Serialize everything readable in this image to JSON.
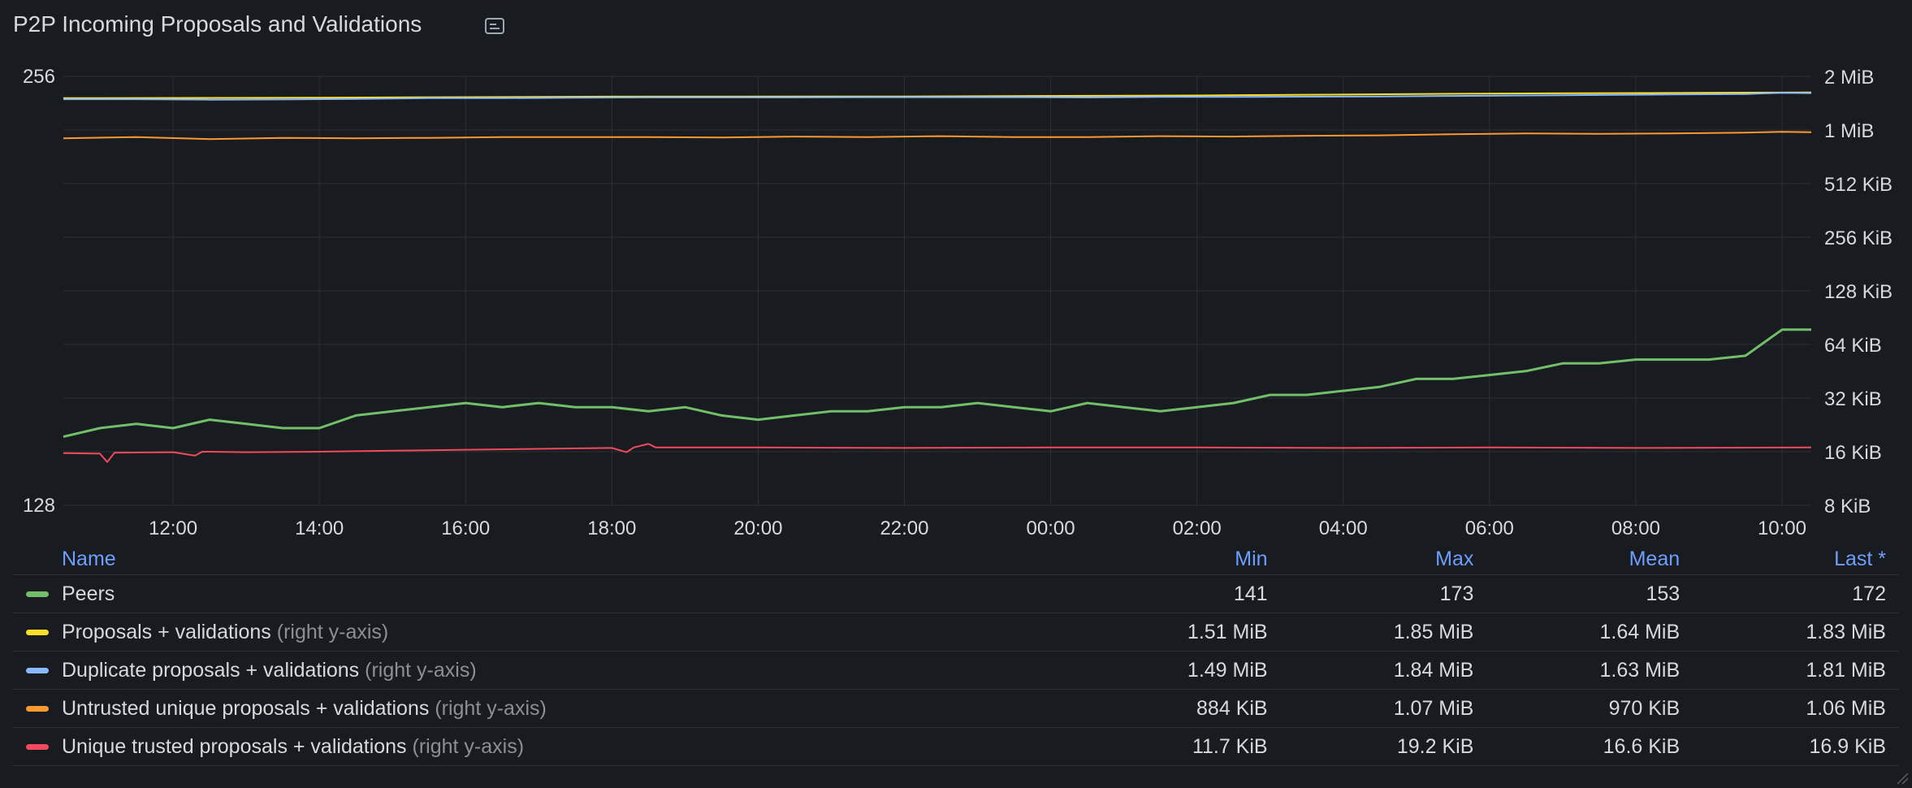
{
  "panel": {
    "title": "P2P Incoming Proposals and Validations",
    "description_icon": "note-icon"
  },
  "colors": {
    "background": "#181b1f",
    "grid": "#2c3036",
    "axis_text": "#d8d9da",
    "legend_header": "#6e9fff"
  },
  "chart_data": {
    "type": "line",
    "x_ticks": [
      "12:00",
      "14:00",
      "16:00",
      "18:00",
      "20:00",
      "22:00",
      "00:00",
      "02:00",
      "04:00",
      "06:00",
      "08:00",
      "10:00"
    ],
    "x_range_hours": [
      10.5,
      34.4
    ],
    "left_axis": {
      "ticks": [
        "256",
        "128"
      ],
      "range": [
        128,
        256
      ],
      "scale": "log2"
    },
    "right_axis": {
      "ticks": [
        "2 MiB",
        "1 MiB",
        "512 KiB",
        "256 KiB",
        "128 KiB",
        "64 KiB",
        "32 KiB",
        "16 KiB",
        "8 KiB"
      ],
      "range_kib": [
        8,
        2048
      ],
      "scale": "log2"
    },
    "grid": true,
    "legend_placement": "bottom (table)",
    "series": [
      {
        "name": "Peers",
        "axis": "left",
        "color": "#73bf69",
        "points": [
          [
            10.5,
            143
          ],
          [
            11.0,
            145
          ],
          [
            11.5,
            146
          ],
          [
            12.0,
            145
          ],
          [
            12.5,
            147
          ],
          [
            13.0,
            146
          ],
          [
            13.5,
            145
          ],
          [
            14.0,
            145
          ],
          [
            14.5,
            148
          ],
          [
            15.0,
            149
          ],
          [
            15.5,
            150
          ],
          [
            16.0,
            151
          ],
          [
            16.5,
            150
          ],
          [
            17.0,
            151
          ],
          [
            17.5,
            150
          ],
          [
            18.0,
            150
          ],
          [
            18.5,
            149
          ],
          [
            19.0,
            150
          ],
          [
            19.5,
            148
          ],
          [
            20.0,
            147
          ],
          [
            20.5,
            148
          ],
          [
            21.0,
            149
          ],
          [
            21.5,
            149
          ],
          [
            22.0,
            150
          ],
          [
            22.5,
            150
          ],
          [
            23.0,
            151
          ],
          [
            23.5,
            150
          ],
          [
            24.0,
            149
          ],
          [
            24.5,
            151
          ],
          [
            25.0,
            150
          ],
          [
            25.5,
            149
          ],
          [
            26.0,
            150
          ],
          [
            26.5,
            151
          ],
          [
            27.0,
            153
          ],
          [
            27.5,
            153
          ],
          [
            28.0,
            154
          ],
          [
            28.5,
            155
          ],
          [
            29.0,
            157
          ],
          [
            29.5,
            157
          ],
          [
            30.0,
            158
          ],
          [
            30.5,
            159
          ],
          [
            31.0,
            161
          ],
          [
            31.5,
            161
          ],
          [
            32.0,
            162
          ],
          [
            32.5,
            162
          ],
          [
            33.0,
            162
          ],
          [
            33.5,
            163
          ],
          [
            34.0,
            170
          ],
          [
            34.4,
            170
          ]
        ]
      },
      {
        "name": "Proposals + validations",
        "axis": "right",
        "color": "#fade2a",
        "points": [
          [
            10.5,
            1546
          ],
          [
            14.0,
            1556
          ],
          [
            18.0,
            1576
          ],
          [
            22.0,
            1580
          ],
          [
            26.0,
            1600
          ],
          [
            30.0,
            1640
          ],
          [
            34.4,
            1665
          ]
        ]
      },
      {
        "name": "Duplicate proposals + validations",
        "axis": "right",
        "color": "#8ab8ff",
        "points": [
          [
            10.5,
            1525
          ],
          [
            11.5,
            1525
          ],
          [
            12.5,
            1515
          ],
          [
            13.5,
            1520
          ],
          [
            14.5,
            1530
          ],
          [
            15.5,
            1545
          ],
          [
            16.5,
            1545
          ],
          [
            17.5,
            1555
          ],
          [
            18.5,
            1560
          ],
          [
            19.5,
            1560
          ],
          [
            20.5,
            1560
          ],
          [
            21.5,
            1565
          ],
          [
            22.5,
            1565
          ],
          [
            23.5,
            1565
          ],
          [
            24.5,
            1560
          ],
          [
            25.5,
            1570
          ],
          [
            26.5,
            1570
          ],
          [
            27.5,
            1575
          ],
          [
            28.5,
            1580
          ],
          [
            29.5,
            1590
          ],
          [
            30.5,
            1600
          ],
          [
            31.5,
            1610
          ],
          [
            32.5,
            1620
          ],
          [
            33.5,
            1630
          ],
          [
            34.0,
            1655
          ],
          [
            34.4,
            1650
          ]
        ]
      },
      {
        "name": "Untrusted unique proposals + validations",
        "axis": "right",
        "color": "#ff9830",
        "points": [
          [
            10.5,
            920
          ],
          [
            11.5,
            935
          ],
          [
            12.5,
            910
          ],
          [
            13.5,
            925
          ],
          [
            14.5,
            920
          ],
          [
            15.5,
            925
          ],
          [
            16.5,
            935
          ],
          [
            17.5,
            935
          ],
          [
            18.5,
            935
          ],
          [
            19.5,
            930
          ],
          [
            20.5,
            940
          ],
          [
            21.5,
            935
          ],
          [
            22.5,
            945
          ],
          [
            23.5,
            935
          ],
          [
            24.5,
            935
          ],
          [
            25.5,
            945
          ],
          [
            26.5,
            940
          ],
          [
            27.5,
            950
          ],
          [
            28.5,
            955
          ],
          [
            29.5,
            970
          ],
          [
            30.5,
            980
          ],
          [
            31.5,
            975
          ],
          [
            32.5,
            980
          ],
          [
            33.5,
            990
          ],
          [
            34.0,
            1000
          ],
          [
            34.4,
            995
          ]
        ]
      },
      {
        "name": "Unique trusted proposals + validations",
        "axis": "right",
        "color": "#f2495c",
        "points": [
          [
            10.5,
            15.7
          ],
          [
            11.0,
            15.6
          ],
          [
            11.1,
            14.0
          ],
          [
            11.2,
            15.8
          ],
          [
            12.0,
            15.9
          ],
          [
            12.3,
            15.2
          ],
          [
            12.4,
            16.0
          ],
          [
            13.0,
            15.9
          ],
          [
            14.0,
            16.0
          ],
          [
            15.0,
            16.2
          ],
          [
            16.0,
            16.4
          ],
          [
            17.0,
            16.6
          ],
          [
            18.0,
            16.8
          ],
          [
            18.2,
            15.9
          ],
          [
            18.3,
            16.9
          ],
          [
            18.5,
            17.7
          ],
          [
            18.6,
            16.9
          ],
          [
            20.0,
            16.9
          ],
          [
            22.0,
            16.8
          ],
          [
            24.0,
            16.9
          ],
          [
            26.0,
            16.9
          ],
          [
            28.0,
            16.8
          ],
          [
            30.0,
            16.9
          ],
          [
            32.0,
            16.8
          ],
          [
            34.4,
            16.9
          ]
        ]
      }
    ]
  },
  "legend": {
    "headers": {
      "name": "Name",
      "min": "Min",
      "max": "Max",
      "mean": "Mean",
      "last": "Last *"
    },
    "rows": [
      {
        "name": "Peers",
        "hint": "",
        "color": "#73bf69",
        "min": "141",
        "max": "173",
        "mean": "153",
        "last": "172"
      },
      {
        "name": "Proposals + validations",
        "hint": "(right y-axis)",
        "color": "#fade2a",
        "min": "1.51 MiB",
        "max": "1.85 MiB",
        "mean": "1.64 MiB",
        "last": "1.83 MiB"
      },
      {
        "name": "Duplicate proposals + validations",
        "hint": "(right y-axis)",
        "color": "#8ab8ff",
        "min": "1.49 MiB",
        "max": "1.84 MiB",
        "mean": "1.63 MiB",
        "last": "1.81 MiB"
      },
      {
        "name": "Untrusted unique proposals + validations",
        "hint": "(right y-axis)",
        "color": "#ff9830",
        "min": "884 KiB",
        "max": "1.07 MiB",
        "mean": "970 KiB",
        "last": "1.06 MiB"
      },
      {
        "name": "Unique trusted proposals + validations",
        "hint": "(right y-axis)",
        "color": "#f2495c",
        "min": "11.7 KiB",
        "max": "19.2 KiB",
        "mean": "16.6 KiB",
        "last": "16.9 KiB"
      }
    ]
  }
}
